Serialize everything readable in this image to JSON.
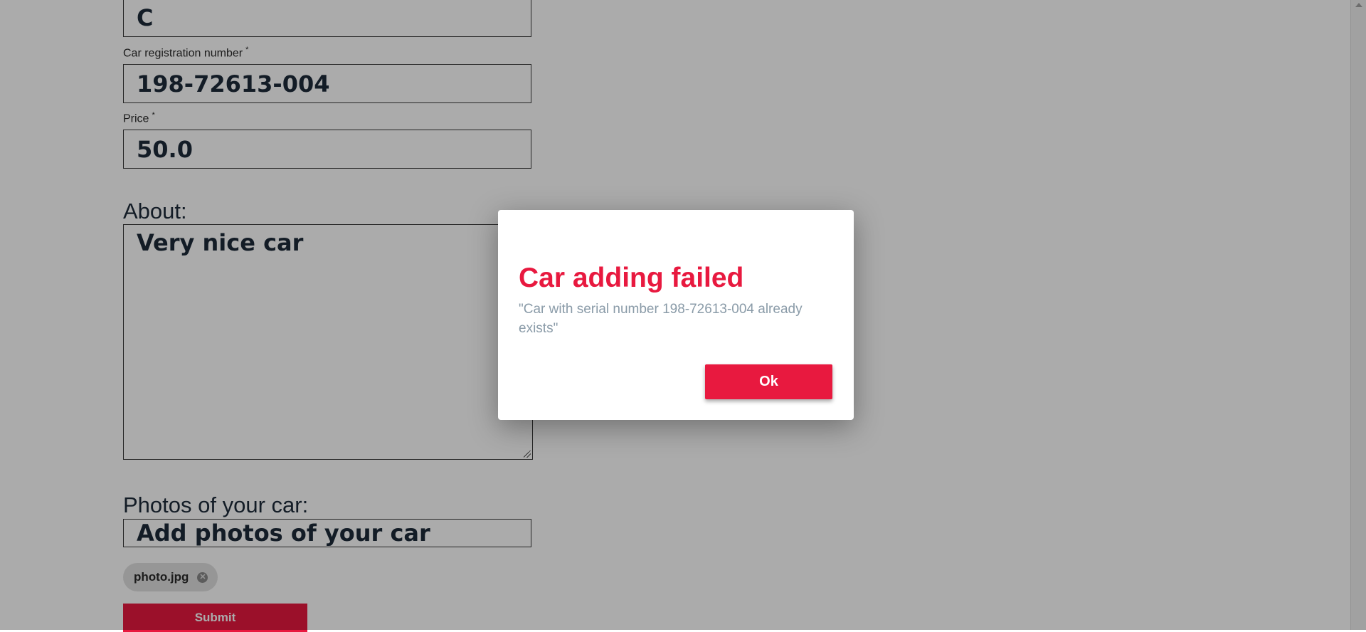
{
  "form": {
    "top_field_value": "C",
    "registration_label": "Car registration number",
    "registration_required_mark": "*",
    "registration_value": "198-72613-004",
    "price_label": "Price",
    "price_required_mark": "*",
    "price_value": "50.0",
    "about_label": "About:",
    "about_value": "Very nice car",
    "photos_label": "Photos of your car:",
    "photos_placeholder": "Add photos of your car",
    "photo_chip": "photo.jpg",
    "submit_label": "Submit"
  },
  "dialog": {
    "title": "Car adding failed",
    "message": "\"Car with serial number 198-72613-004 already exists\"",
    "ok_label": "Ok"
  },
  "icons": {
    "chip_remove": "close-circle-icon",
    "scroll_up": "scroll-up-arrow-icon",
    "resize": "resize-grip-icon"
  },
  "colors": {
    "accent": "#e8193f",
    "text": "#1d2b3a",
    "message": "#8a9ba8"
  }
}
